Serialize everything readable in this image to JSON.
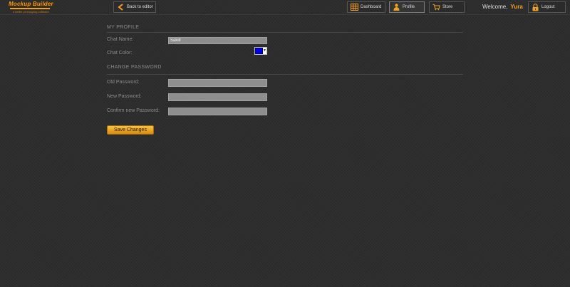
{
  "logo": {
    "name": "Mockup Builder",
    "tagline": "a better prototyping software"
  },
  "toolbar": {
    "back_label": "Back to editor",
    "dashboard_label": "Dashboard",
    "profile_label": "Profile",
    "store_label": "Store",
    "welcome_text": "Welcome,",
    "username": "Yura",
    "logout_label": "Logout"
  },
  "profile": {
    "section_title": "MY PROFILE",
    "chat_name_label": "Chat Name:",
    "chat_name_value": "Sakilf",
    "chat_color_label": "Chat Color:",
    "chat_color_value": "#0000ee"
  },
  "password": {
    "section_title": "CHANGE PASSWORD",
    "old_label": "Old Password:",
    "old_value": "",
    "new_label": "New Password:",
    "new_value": "",
    "confirm_label": "Confirm new Password:",
    "confirm_value": ""
  },
  "actions": {
    "save_label": "Save Changes"
  },
  "colors": {
    "accent": "#f0a020",
    "background": "#2d2d2d",
    "field": "#8e8e8e"
  }
}
